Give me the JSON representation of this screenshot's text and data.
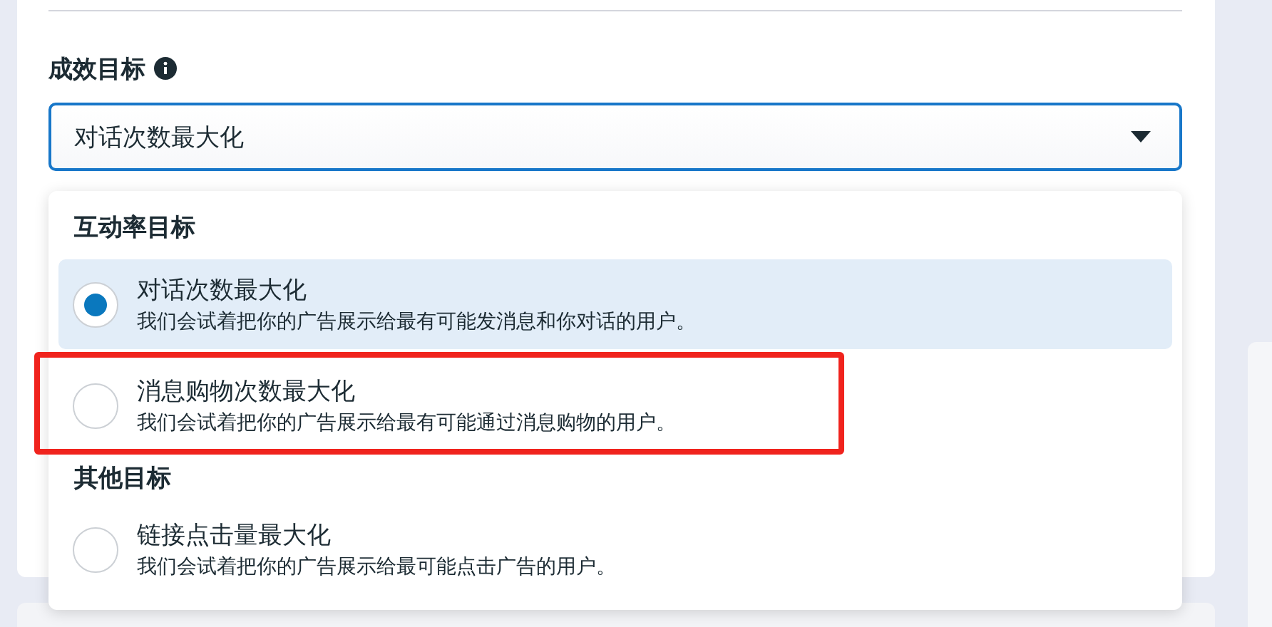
{
  "field": {
    "label": "成效目标",
    "value": "对话次数最大化"
  },
  "dropdown": {
    "groups": [
      {
        "heading": "互动率目标",
        "options": [
          {
            "title": "对话次数最大化",
            "description": "我们会试着把你的广告展示给最有可能发消息和你对话的用户。",
            "selected": true,
            "highlighted": false
          },
          {
            "title": "消息购物次数最大化",
            "description": "我们会试着把你的广告展示给最有可能通过消息购物的用户。",
            "selected": false,
            "highlighted": true
          }
        ]
      },
      {
        "heading": "其他目标",
        "options": [
          {
            "title": "链接点击量最大化",
            "description": "我们会试着把你的广告展示给最可能点击广告的用户。",
            "selected": false,
            "highlighted": false
          }
        ]
      }
    ]
  }
}
